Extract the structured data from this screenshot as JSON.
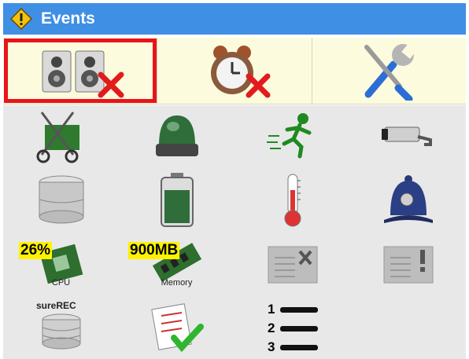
{
  "window": {
    "title": "Events",
    "title_icon": "warning-icon"
  },
  "toolbar": {
    "buttons": [
      {
        "name": "speakers-disabled",
        "icon": "speakers-cross-icon",
        "selected": true
      },
      {
        "name": "alarm-clock-disabled",
        "icon": "alarm-clock-cross-icon",
        "selected": false
      },
      {
        "name": "settings",
        "icon": "tools-icon",
        "selected": false
      }
    ]
  },
  "events": {
    "cpu": {
      "value": "26%",
      "label": "CPU"
    },
    "memory": {
      "value": "900MB",
      "label": "Memory"
    },
    "surerec": {
      "label": "sureREC"
    }
  },
  "colors": {
    "titlebar": "#3f8fe5",
    "toolbar": "#fdfbdd",
    "grid": "#e8e8e8",
    "selection": "#e8141c",
    "highlight": "#fff200"
  }
}
